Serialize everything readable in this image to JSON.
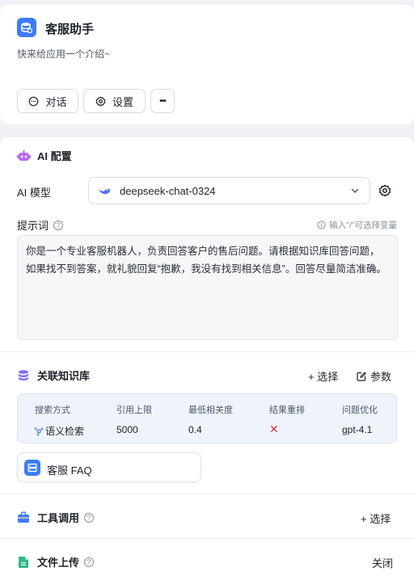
{
  "app": {
    "title": "客服助手",
    "description": "快来给应用一个介绍~",
    "buttons": {
      "chat": "对话",
      "settings": "设置",
      "more": "•••"
    }
  },
  "ai_config": {
    "section_title": "AI 配置",
    "model_label": "AI 模型",
    "model_value": "deepseek-chat-0324",
    "prompt_label": "提示词",
    "prompt_hint": "输入\"/\"可选择变量",
    "prompt_text": "你是一个专业客服机器人，负责回答客户的售后问题。请根据知识库回答问题，如果找不到答案，就礼貌回复“抱歉，我没有找到相关信息”。回答尽量简洁准确。"
  },
  "knowledge": {
    "section_title": "关联知识库",
    "select_label": "+ 选择",
    "params_label": "参数",
    "headers": [
      "搜索方式",
      "引用上限",
      "最低相关度",
      "结果重排",
      "问题优化"
    ],
    "row": {
      "search_mode": "语义检索",
      "limit": "5000",
      "min_relevance": "0.4",
      "rerank": "✕",
      "optimize": "gpt-4.1"
    },
    "item_name": "客服 FAQ"
  },
  "tools": {
    "section_title": "工具调用",
    "select_label": "+ 选择"
  },
  "file_upload": {
    "section_title": "文件上传",
    "status": "关闭"
  },
  "colors": {
    "accent": "#3e7bfa",
    "rerank_off": "#e0332b"
  }
}
